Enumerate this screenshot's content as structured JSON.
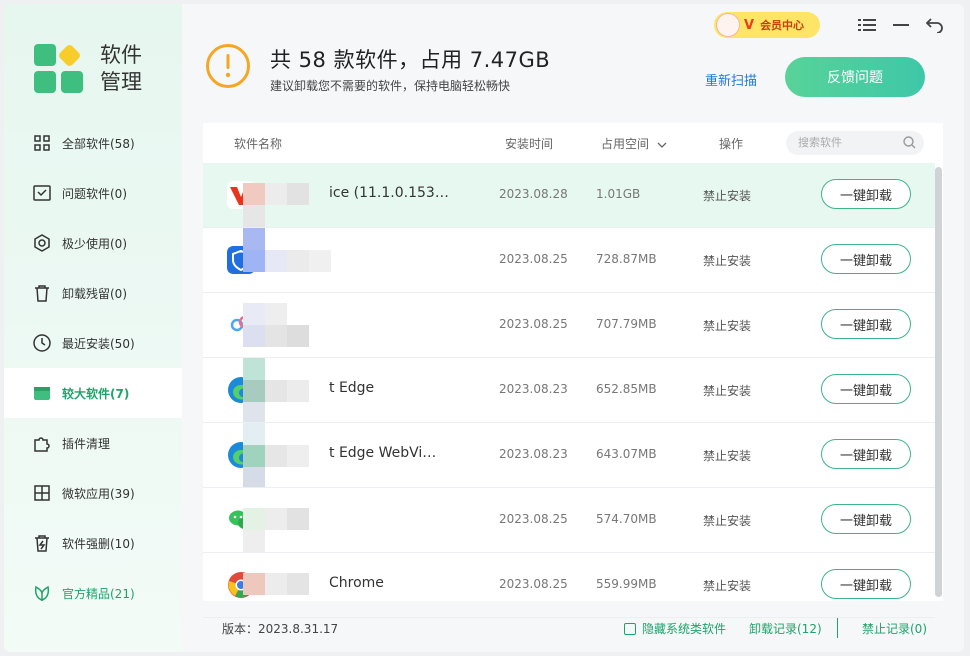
{
  "app": {
    "logo_text": "软件管理",
    "brand_colors": {
      "green": "#3fbf7f",
      "yellow": "#f7cc2b",
      "accent": "#1fa36b"
    }
  },
  "topbar": {
    "vip_badge_letter": "V",
    "vip_label": "会员中心"
  },
  "sidebar": {
    "items": [
      {
        "label": "全部软件(58)",
        "icon": "grid-icon"
      },
      {
        "label": "问题软件(0)",
        "icon": "problem-icon"
      },
      {
        "label": "极少使用(0)",
        "icon": "rarely-used-icon"
      },
      {
        "label": "卸载残留(0)",
        "icon": "trash-icon"
      },
      {
        "label": "最近安装(50)",
        "icon": "clock-icon"
      },
      {
        "label": "较大软件(7)",
        "icon": "box-icon",
        "active": true
      },
      {
        "label": "插件清理",
        "icon": "puzzle-icon"
      },
      {
        "label": "微软应用(39)",
        "icon": "windows-icon"
      },
      {
        "label": "软件强删(10)",
        "icon": "force-delete-icon"
      },
      {
        "label": "官方精品(21)",
        "icon": "leaf-icon"
      }
    ]
  },
  "header": {
    "title": "共 58 款软件，占用 7.47GB",
    "subtitle": "建议卸载您不需要的软件，保持电脑轻松畅快",
    "rescan_label": "重新扫描",
    "feedback_label": "反馈问题"
  },
  "table": {
    "columns": {
      "name": "软件名称",
      "install_time": "安装时间",
      "size": "占用空间",
      "action": "操作"
    },
    "search_placeholder": "搜索软件",
    "rows": [
      {
        "name": "ice (11.1.0.153…",
        "date": "2023.08.28",
        "size": "1.01GB",
        "status": "禁止安装",
        "button": "一键卸载",
        "icon_color": "#e8341c"
      },
      {
        "name": "",
        "date": "2023.08.25",
        "size": "728.87MB",
        "status": "禁止安装",
        "button": "一键卸载",
        "icon_color": "#1f6fe0"
      },
      {
        "name": "",
        "date": "2023.08.25",
        "size": "707.79MB",
        "status": "禁止安装",
        "button": "一键卸载",
        "icon_color": "#4aa8f0"
      },
      {
        "name": "t Edge",
        "date": "2023.08.23",
        "size": "652.85MB",
        "status": "禁止安装",
        "button": "一键卸载",
        "icon_color": "#1b8ad8"
      },
      {
        "name": "t Edge WebVi…",
        "date": "2023.08.23",
        "size": "643.07MB",
        "status": "禁止安装",
        "button": "一键卸载",
        "icon_color": "#1b8ad8"
      },
      {
        "name": "",
        "date": "2023.08.25",
        "size": "574.70MB",
        "status": "禁止安装",
        "button": "一键卸载",
        "icon_color": "#35c25a"
      },
      {
        "name": "Chrome",
        "date": "2023.08.25",
        "size": "559.99MB",
        "status": "禁止安装",
        "button": "一键卸载",
        "icon_color": "#e04a3a"
      }
    ]
  },
  "footer": {
    "version": "版本：2023.8.31.17",
    "hide_system_label": "隐藏系统类软件",
    "uninstall_record": "卸载记录(12)",
    "blocked_record": "禁止记录(0)"
  }
}
